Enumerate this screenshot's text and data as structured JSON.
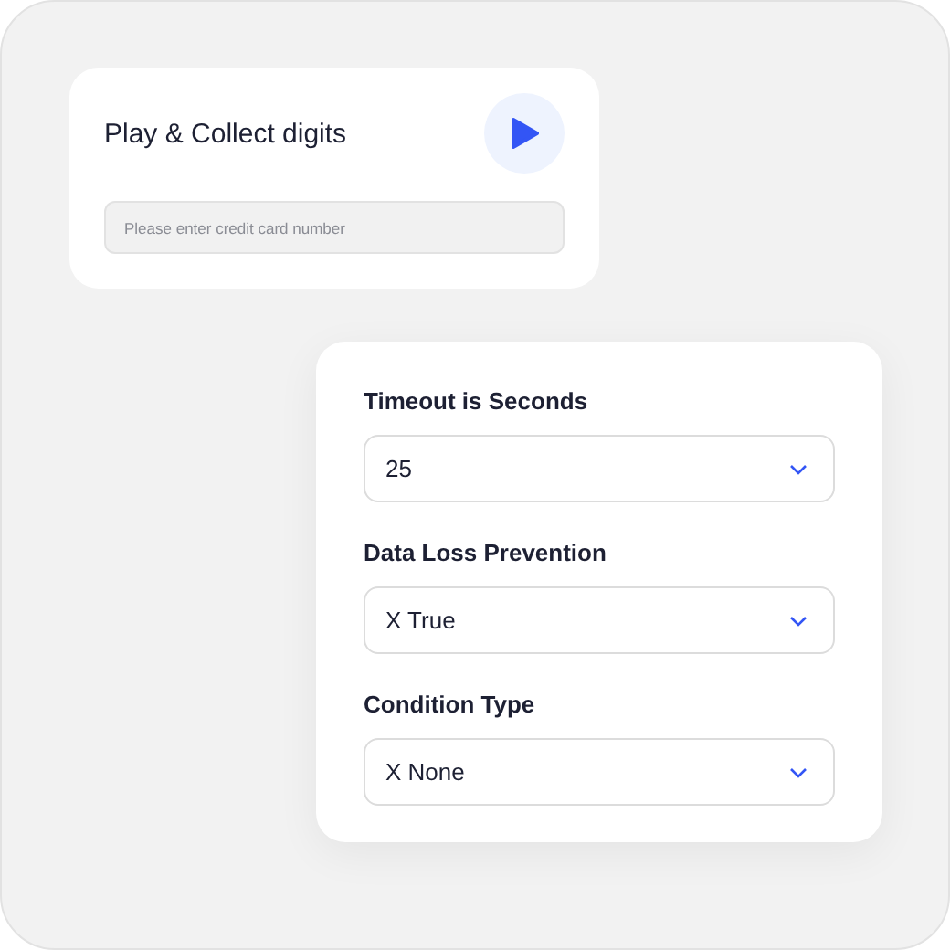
{
  "player_card": {
    "title": "Play & Collect digits",
    "input": {
      "placeholder": "Please enter credit card number"
    }
  },
  "settings_card": {
    "fields": [
      {
        "label": "Timeout is Seconds",
        "value": "25"
      },
      {
        "label": "Data Loss Prevention",
        "value": "X True"
      },
      {
        "label": "Condition Type",
        "value": "X None"
      }
    ]
  }
}
